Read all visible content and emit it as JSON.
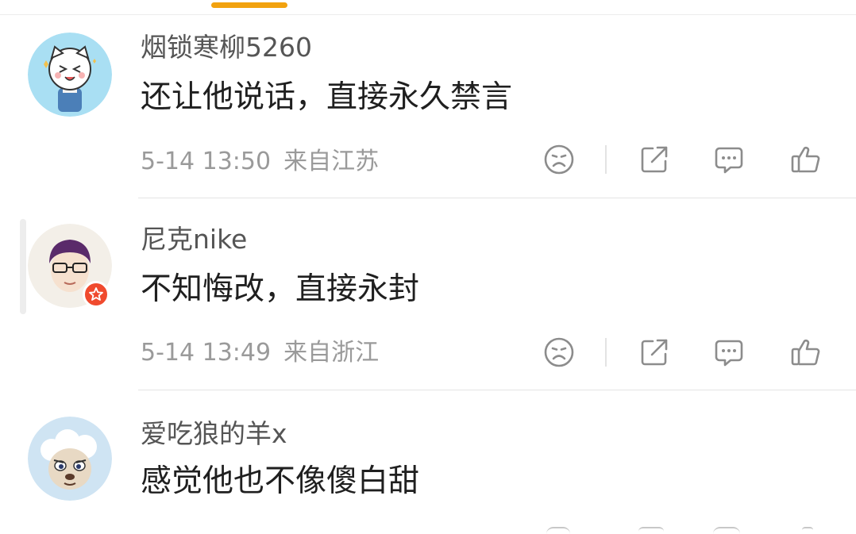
{
  "comments": [
    {
      "username": "烟锁寒柳5260",
      "content": "还让他说话，直接永久禁言",
      "time": "5-14 13:50",
      "location": "来自江苏",
      "avatar": "cartoon-cat-avatar",
      "vip_badge": false
    },
    {
      "username": "尼克nike",
      "content": "不知悔改，直接永封",
      "time": "5-14 13:49",
      "location": "来自浙江",
      "avatar": "glasses-man-avatar",
      "vip_badge": true
    },
    {
      "username": "爱吃狼的羊x",
      "content": "感觉他也不像傻白甜",
      "avatar": "cartoon-sheep-avatar",
      "vip_badge": false
    }
  ],
  "icons": {
    "dislike": "sad-face-icon",
    "share": "share-icon",
    "comment": "comment-icon",
    "like": "thumbs-up-icon"
  },
  "colors": {
    "accent": "#f2a20f",
    "username": "#555555",
    "text": "#1f1f1f",
    "meta": "#9a9a9a",
    "icon": "#8c8c8c",
    "badge": "#f04a2e"
  }
}
